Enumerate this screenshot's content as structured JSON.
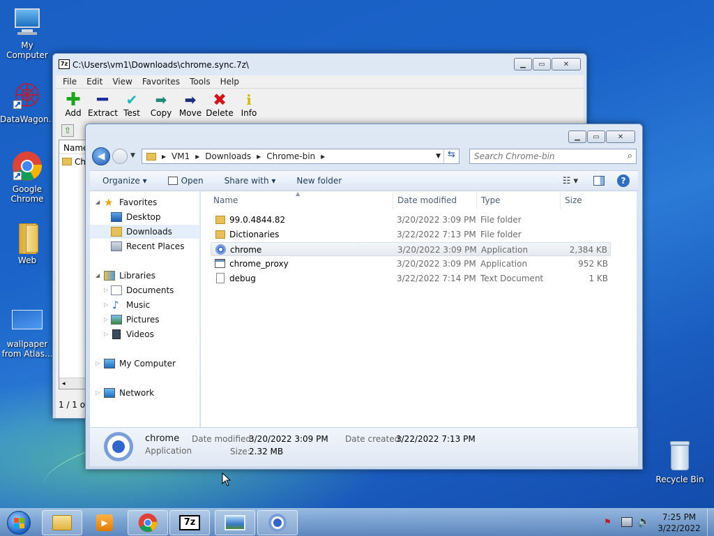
{
  "desktop": {
    "icons": [
      {
        "label": "My Computer"
      },
      {
        "label": "DataWagon..."
      },
      {
        "label": "Google Chrome"
      },
      {
        "label": "Web"
      },
      {
        "label": "wallpaper from Atlas..."
      },
      {
        "label": "Recycle Bin"
      }
    ]
  },
  "zip_window": {
    "title": "C:\\Users\\vm1\\Downloads\\chrome.sync.7z\\",
    "menu": [
      "File",
      "Edit",
      "View",
      "Favorites",
      "Tools",
      "Help"
    ],
    "toolbar": [
      {
        "label": "Add",
        "icon": "plus-icon"
      },
      {
        "label": "Extract",
        "icon": "minus-icon"
      },
      {
        "label": "Test",
        "icon": "check-icon"
      },
      {
        "label": "Copy",
        "icon": "copy-arrow-icon"
      },
      {
        "label": "Move",
        "icon": "move-arrow-icon"
      },
      {
        "label": "Delete",
        "icon": "x-icon"
      },
      {
        "label": "Info",
        "icon": "info-icon"
      }
    ],
    "list_header": "Name",
    "list_item": "Ch",
    "status": "1 / 1 ob"
  },
  "explorer": {
    "breadcrumb": [
      "VM1",
      "Downloads",
      "Chrome-bin"
    ],
    "search_placeholder": "Search Chrome-bin",
    "commands": {
      "organize": "Organize",
      "open": "Open",
      "share": "Share with",
      "new_folder": "New folder"
    },
    "nav": {
      "favorites": "Favorites",
      "desktop": "Desktop",
      "downloads": "Downloads",
      "recent": "Recent Places",
      "libraries": "Libraries",
      "documents": "Documents",
      "music": "Music",
      "pictures": "Pictures",
      "videos": "Videos",
      "computer": "My Computer",
      "network": "Network"
    },
    "columns": {
      "name": "Name",
      "date": "Date modified",
      "type": "Type",
      "size": "Size"
    },
    "files": [
      {
        "name": "99.0.4844.82",
        "date": "3/20/2022 3:09 PM",
        "type": "File folder",
        "size": ""
      },
      {
        "name": "Dictionaries",
        "date": "3/22/2022 7:13 PM",
        "type": "File folder",
        "size": ""
      },
      {
        "name": "chrome",
        "date": "3/20/2022 3:09 PM",
        "type": "Application",
        "size": "2,384 KB"
      },
      {
        "name": "chrome_proxy",
        "date": "3/20/2022 3:09 PM",
        "type": "Application",
        "size": "952 KB"
      },
      {
        "name": "debug",
        "date": "3/22/2022 7:14 PM",
        "type": "Text Document",
        "size": "1 KB"
      }
    ],
    "details": {
      "name": "chrome",
      "kind": "Application",
      "modified_label": "Date modified:",
      "modified": "3/20/2022 3:09 PM",
      "created_label": "Date created:",
      "created": "3/22/2022 7:13 PM",
      "size_label": "Size:",
      "size": "2.32 MB"
    }
  },
  "taskbar": {
    "clock_time": "7:25 PM",
    "clock_date": "3/22/2022"
  }
}
